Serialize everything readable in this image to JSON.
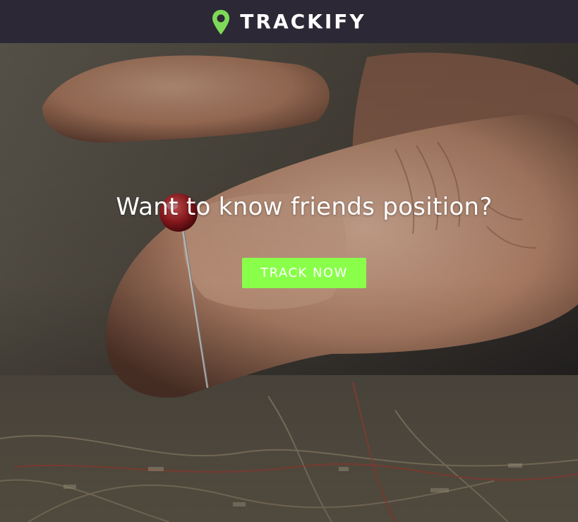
{
  "header": {
    "brand": "TRACKIFY",
    "logo_icon": "map-pin-icon",
    "background_color": "#2c2836",
    "accent_color": "#7ed957"
  },
  "hero": {
    "headline": "Want to know friends position?",
    "cta_label": "TRACK NOW",
    "cta_color": "#89ff4a",
    "background_image": "hand-pinning-map-photo"
  }
}
